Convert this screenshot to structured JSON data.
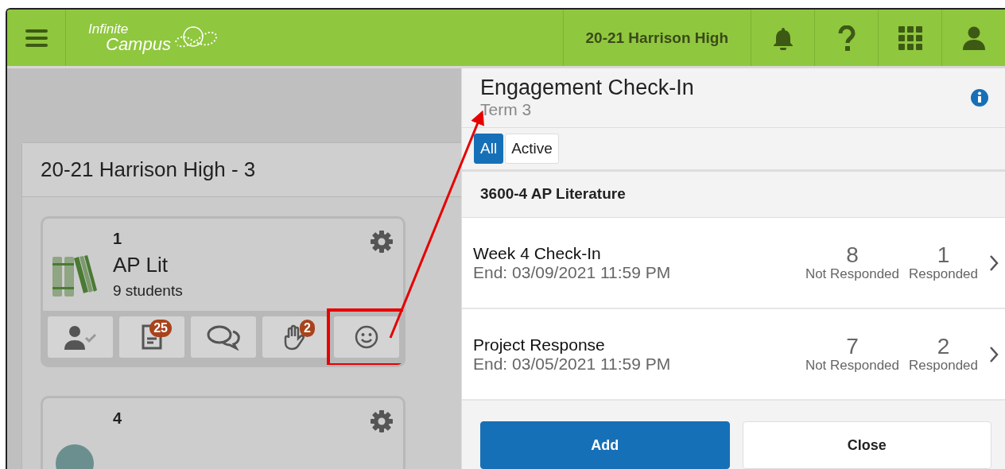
{
  "header": {
    "logo_line1": "Infinite",
    "logo_line2": "Campus",
    "school": "20-21 Harrison High"
  },
  "calendar": {
    "title": "20-21 Harrison High - 3",
    "sections": [
      {
        "period": "1",
        "name": "AP Lit",
        "students": "9 students",
        "tools": [
          {
            "kind": "attendance",
            "highlighted": false
          },
          {
            "kind": "grades",
            "badge": "25",
            "highlighted": false
          },
          {
            "kind": "messages",
            "highlighted": false
          },
          {
            "kind": "participation",
            "badge": "2",
            "highlighted": false
          },
          {
            "kind": "engagement",
            "highlighted": true
          }
        ]
      },
      {
        "period": "4"
      }
    ]
  },
  "panel": {
    "title": "Engagement Check-In",
    "term": "Term 3",
    "filters": [
      {
        "label": "All",
        "selected": true
      },
      {
        "label": "Active",
        "selected": false
      }
    ],
    "section": "3600-4 AP Literature",
    "items": [
      {
        "name": "Week 4 Check-In",
        "end": "End: 03/09/2021 11:59 PM",
        "not_responded": "8",
        "not_responded_label": "Not Responded",
        "responded": "1",
        "responded_label": "Responded"
      },
      {
        "name": "Project Response",
        "end": "End: 03/05/2021 11:59 PM",
        "not_responded": "7",
        "not_responded_label": "Not Responded",
        "responded": "2",
        "responded_label": "Responded"
      }
    ],
    "buttons": [
      {
        "label": "Add",
        "kind": "primary"
      },
      {
        "label": "Close",
        "kind": "secondary"
      }
    ]
  }
}
